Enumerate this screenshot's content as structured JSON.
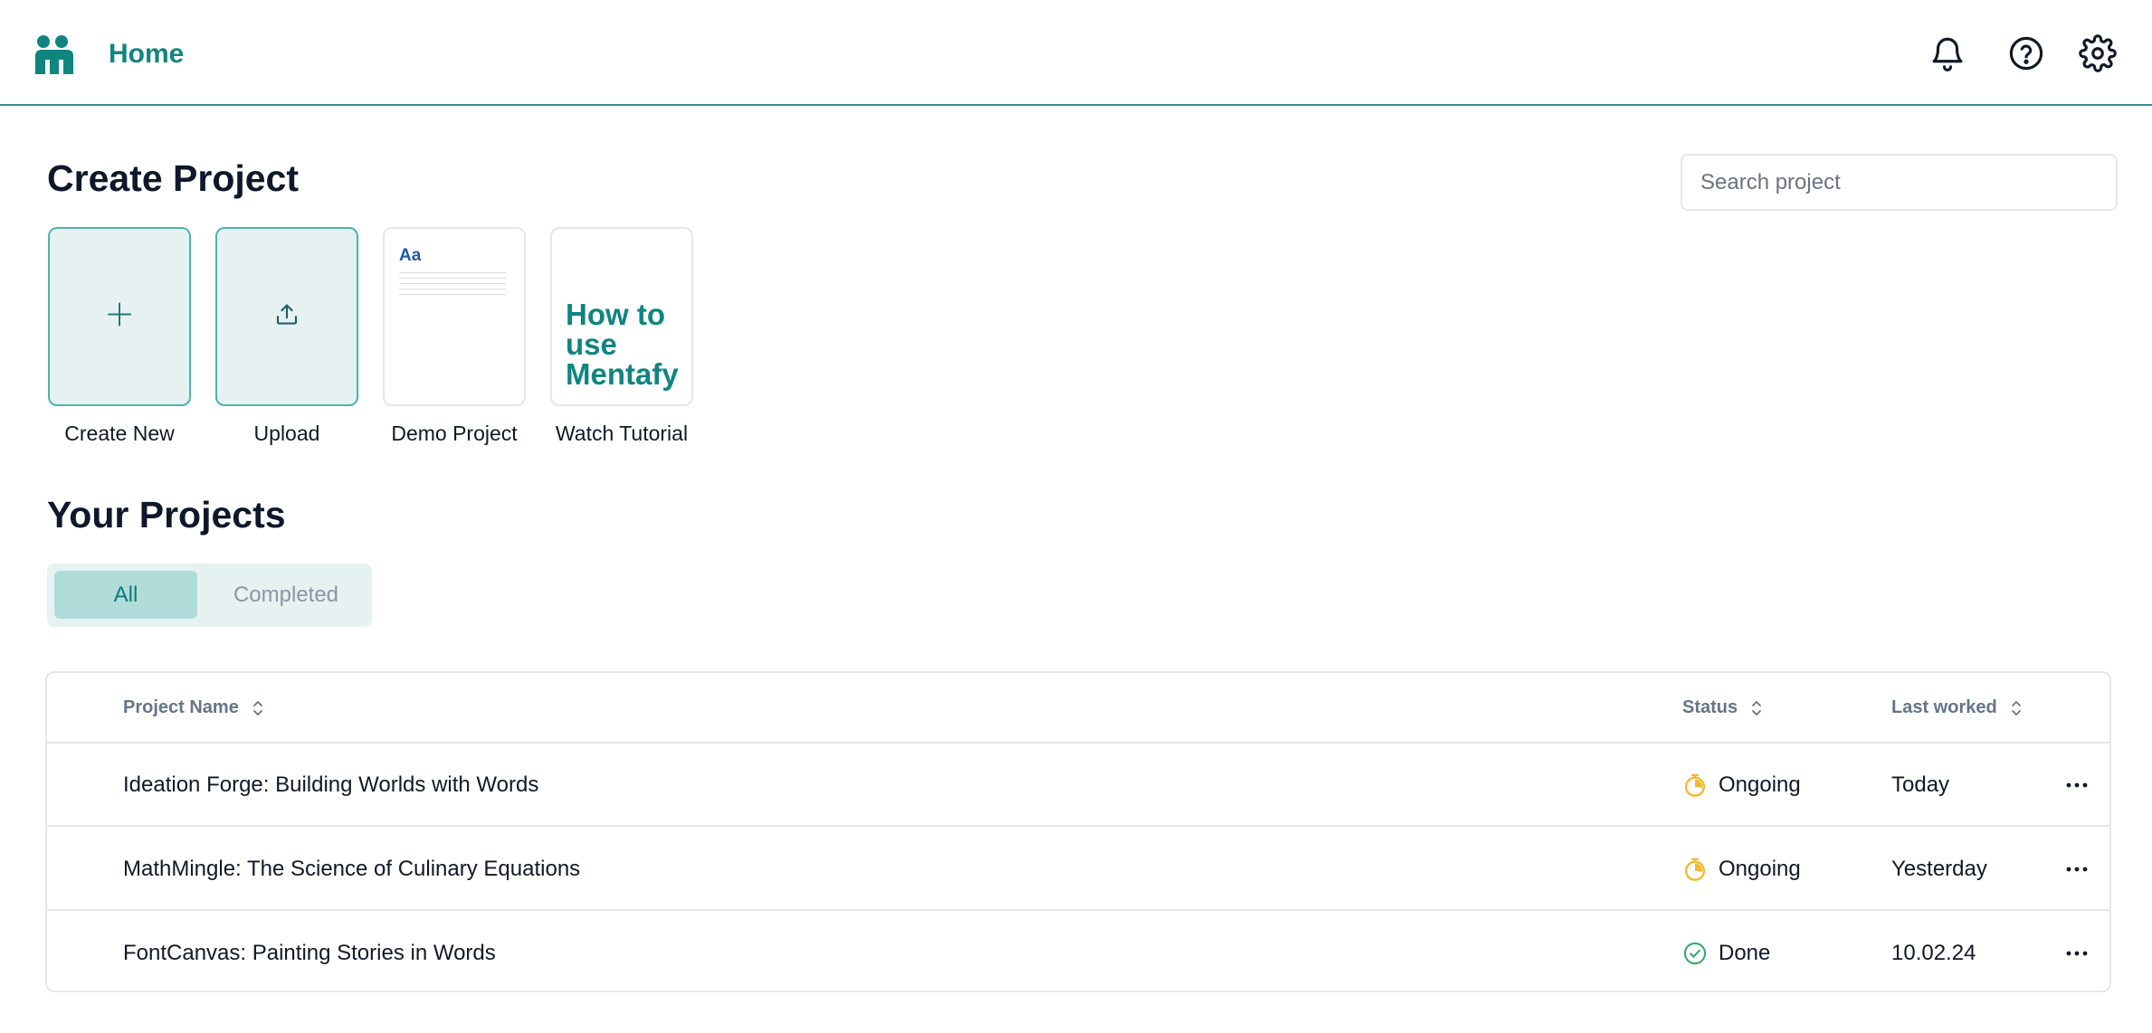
{
  "header": {
    "title": "Home",
    "icons": [
      "notification-bell-icon",
      "help-circle-icon",
      "settings-gear-icon"
    ],
    "accent_color": "#0f8580"
  },
  "create_section": {
    "title": "Create Project",
    "search": {
      "placeholder": "Search project",
      "value": ""
    },
    "tiles": [
      {
        "label": "Create New",
        "icon": "plus-icon"
      },
      {
        "label": "Upload",
        "icon": "upload-icon"
      },
      {
        "label": "Demo Project",
        "thumb_text": "Aa"
      },
      {
        "label": "Watch Tutorial",
        "thumb_text_lines": [
          "How to",
          "use",
          "Mentafy"
        ]
      }
    ]
  },
  "projects_section": {
    "title": "Your Projects",
    "filters": [
      {
        "label": "All",
        "active": true
      },
      {
        "label": "Completed",
        "active": false
      }
    ],
    "columns": [
      "Project Name",
      "Status",
      "Last worked"
    ],
    "rows": [
      {
        "name": "Ideation Forge: Building Worlds with Words",
        "status": "Ongoing",
        "status_icon": "stopwatch-icon",
        "last_worked": "Today"
      },
      {
        "name": "MathMingle: The Science of Culinary Equations",
        "status": "Ongoing",
        "status_icon": "stopwatch-icon",
        "last_worked": "Yesterday"
      },
      {
        "name": "FontCanvas: Painting Stories in Words",
        "status": "Done",
        "status_icon": "check-circle-icon",
        "last_worked": "10.02.24"
      }
    ]
  },
  "colors": {
    "ongoing": "#f5b82e",
    "done": "#3aa76d",
    "tile_bg": "#e6f2f1",
    "tile_border": "#4fb2ad"
  }
}
